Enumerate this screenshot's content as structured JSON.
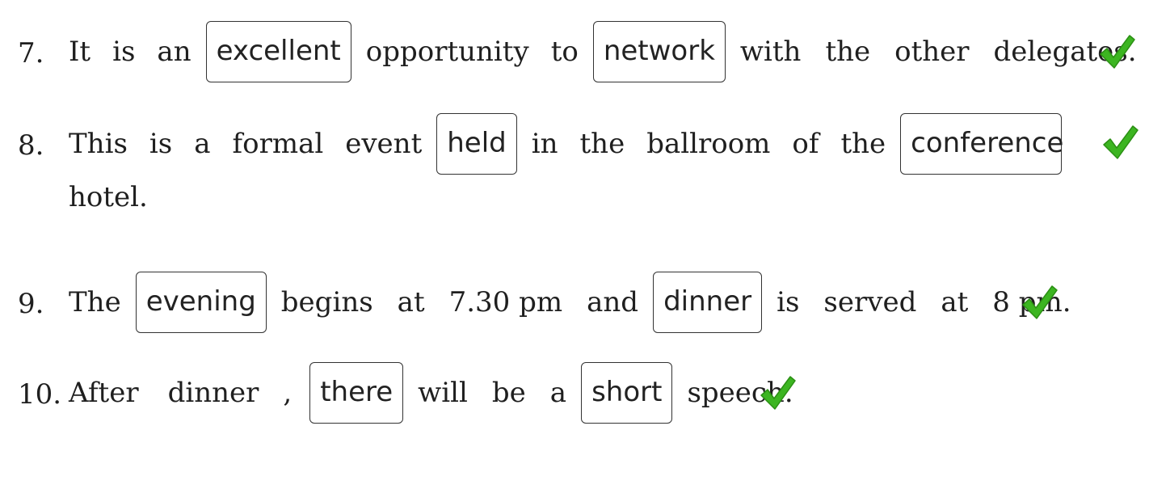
{
  "exercise": {
    "items": [
      {
        "number": "7.",
        "parts": [
          "It",
          "is",
          "an",
          "opportunity",
          "to",
          "with",
          "the",
          "other",
          "delegates."
        ],
        "answers": [
          "excellent",
          "network"
        ],
        "status": "check-icon"
      },
      {
        "number": "8.",
        "parts": [
          "This",
          "is",
          "a",
          "formal",
          "event",
          "in",
          "the",
          "ballroom",
          "of",
          "the",
          "hotel."
        ],
        "answers": [
          "held",
          "conference"
        ],
        "status": "check-icon"
      },
      {
        "number": "9.",
        "parts": [
          "The",
          "begins",
          "at",
          "7.30 pm",
          "and",
          "is",
          "served",
          "at",
          "8 pm."
        ],
        "answers": [
          "evening",
          "dinner"
        ],
        "status": "check-icon"
      },
      {
        "number": "10.",
        "parts": [
          "After",
          "dinner",
          ",",
          "will",
          "be",
          "a",
          "speech."
        ],
        "answers": [
          "there",
          "short"
        ],
        "status": "check-icon"
      }
    ]
  },
  "colors": {
    "check_green": "#3cb521",
    "check_green_dark": "#2b8f14",
    "box_border": "#333333"
  }
}
